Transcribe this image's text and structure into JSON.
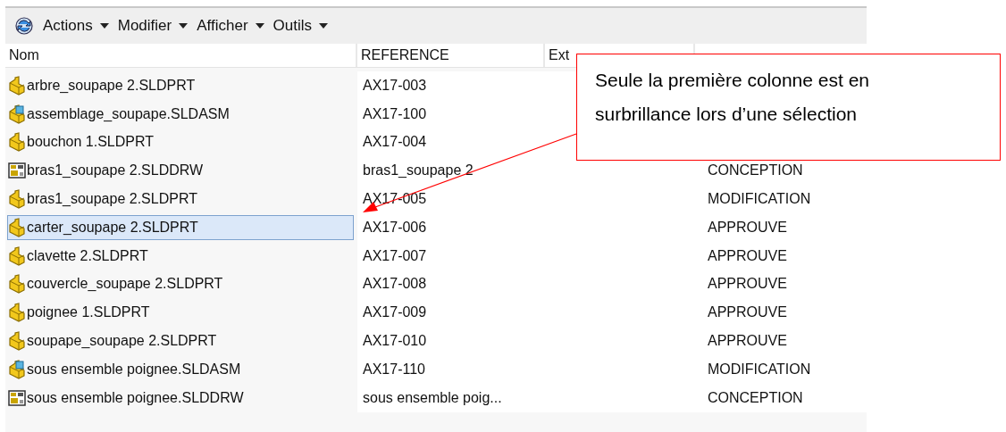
{
  "toolbar": {
    "menus": [
      {
        "label": "Actions"
      },
      {
        "label": "Modifier"
      },
      {
        "label": "Afficher"
      },
      {
        "label": "Outils"
      }
    ]
  },
  "table": {
    "columns": [
      "Nom",
      "REFERENCE",
      "Ext"
    ],
    "rows": [
      {
        "kind": "part",
        "name": "arbre_soupape 2.SLDPRT",
        "reference": "AX17-003",
        "selected": false
      },
      {
        "kind": "assembly",
        "name": "assemblage_soupape.SLDASM",
        "reference": "AX17-100",
        "selected": false
      },
      {
        "kind": "part",
        "name": "bouchon 1.SLDPRT",
        "reference": "AX17-004",
        "selected": false
      },
      {
        "kind": "drawing",
        "name": "bras1_soupape 2.SLDDRW",
        "reference": "bras1_soupape 2",
        "state": "CONCEPTION",
        "selected": false
      },
      {
        "kind": "part",
        "name": "bras1_soupape 2.SLDPRT",
        "reference": "AX17-005",
        "state": "MODIFICATION",
        "selected": false
      },
      {
        "kind": "part",
        "name": "carter_soupape 2.SLDPRT",
        "reference": "AX17-006",
        "state": "APPROUVE",
        "selected": true
      },
      {
        "kind": "part",
        "name": "clavette 2.SLDPRT",
        "reference": "AX17-007",
        "state": "APPROUVE",
        "selected": false
      },
      {
        "kind": "part",
        "name": "couvercle_soupape 2.SLDPRT",
        "reference": "AX17-008",
        "state": "APPROUVE",
        "selected": false
      },
      {
        "kind": "part",
        "name": "poignee 1.SLDPRT",
        "reference": "AX17-009",
        "state": "APPROUVE",
        "selected": false
      },
      {
        "kind": "part",
        "name": "soupape_soupape 2.SLDPRT",
        "reference": "AX17-010",
        "state": "APPROUVE",
        "selected": false
      },
      {
        "kind": "assembly",
        "name": "sous ensemble poignee.SLDASM",
        "reference": "AX17-110",
        "state": "MODIFICATION",
        "selected": false
      },
      {
        "kind": "drawing",
        "name": "sous ensemble poignee.SLDDRW",
        "reference": "sous ensemble poig...",
        "state": "CONCEPTION",
        "selected": false
      }
    ]
  },
  "callout": {
    "text": "Seule la première colonne est en surbrillance lors d’une sélection"
  }
}
